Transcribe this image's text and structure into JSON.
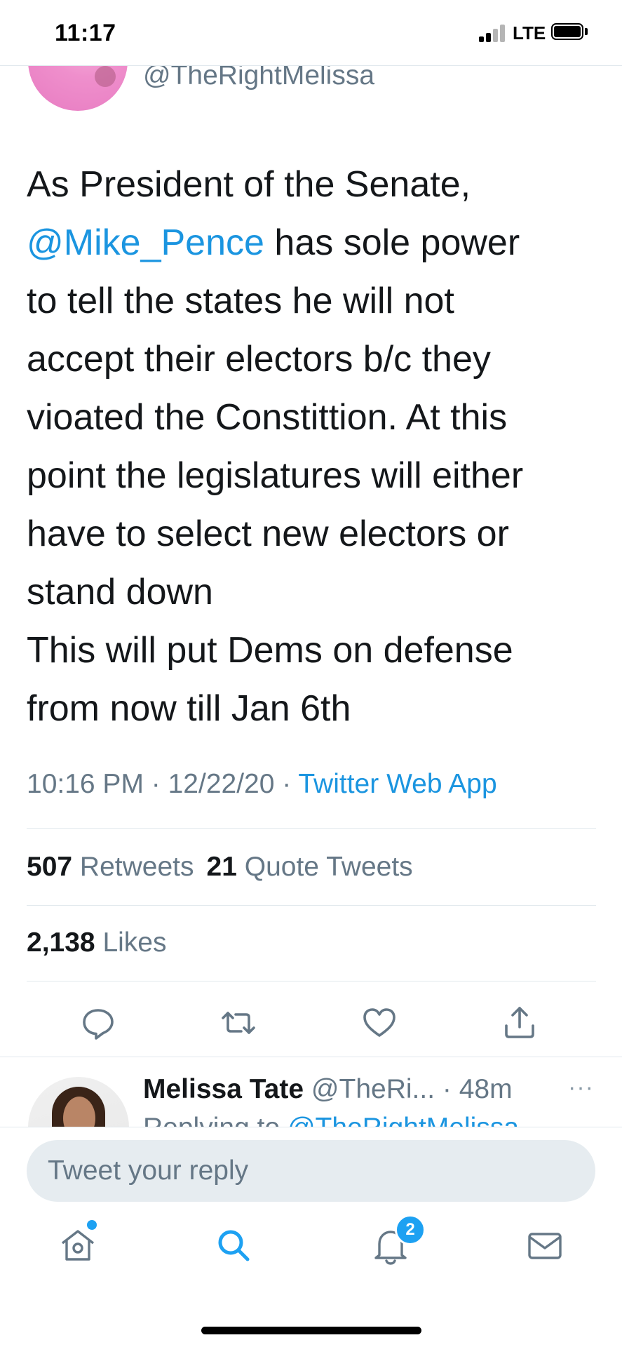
{
  "status_bar": {
    "time": "11:17",
    "network": "LTE"
  },
  "tweet": {
    "handle": "@TheRightMelissa",
    "text_lines": [
      [
        "As President of the Senate,"
      ],
      [
        "@Mike_Pence",
        " has sole power"
      ],
      [
        "to tell the states he will not"
      ],
      [
        "accept their electors b/c they"
      ],
      [
        "vioated the Constittion. At this"
      ],
      [
        "point the legislatures will either"
      ],
      [
        "have to select new electors or"
      ],
      [
        "stand down"
      ],
      [
        "This will put Dems on defense"
      ],
      [
        "from now till Jan 6th"
      ]
    ],
    "mention": "@Mike_Pence",
    "mention_rest": " has sole power",
    "time": "10:16 PM",
    "date": "12/22/20",
    "source": "Twitter Web App",
    "retweets_count": "507",
    "retweets_label": "Retweets",
    "quotes_count": "21",
    "quotes_label": "Quote Tweets",
    "likes_count": "2,138",
    "likes_label": "Likes"
  },
  "actions": {
    "icons": [
      "reply-icon",
      "retweet-icon",
      "like-icon",
      "share-icon"
    ]
  },
  "reply_preview": {
    "name": "Melissa Tate",
    "handle": "@TheRi...",
    "time": "· 48m",
    "more": "···",
    "replying_prefix": "Replying to",
    "replying_to": "@TheRightMelissa"
  },
  "compose": {
    "placeholder": "Tweet your reply"
  },
  "tabbar": {
    "items": [
      "home-icon",
      "search-icon",
      "notifications-icon",
      "messages-icon"
    ],
    "notifications_badge": "2",
    "accent_color": "#1da1f2"
  },
  "colors": {
    "link": "#1b95e0",
    "secondary_text": "#657786",
    "primary_text": "#14171a"
  }
}
